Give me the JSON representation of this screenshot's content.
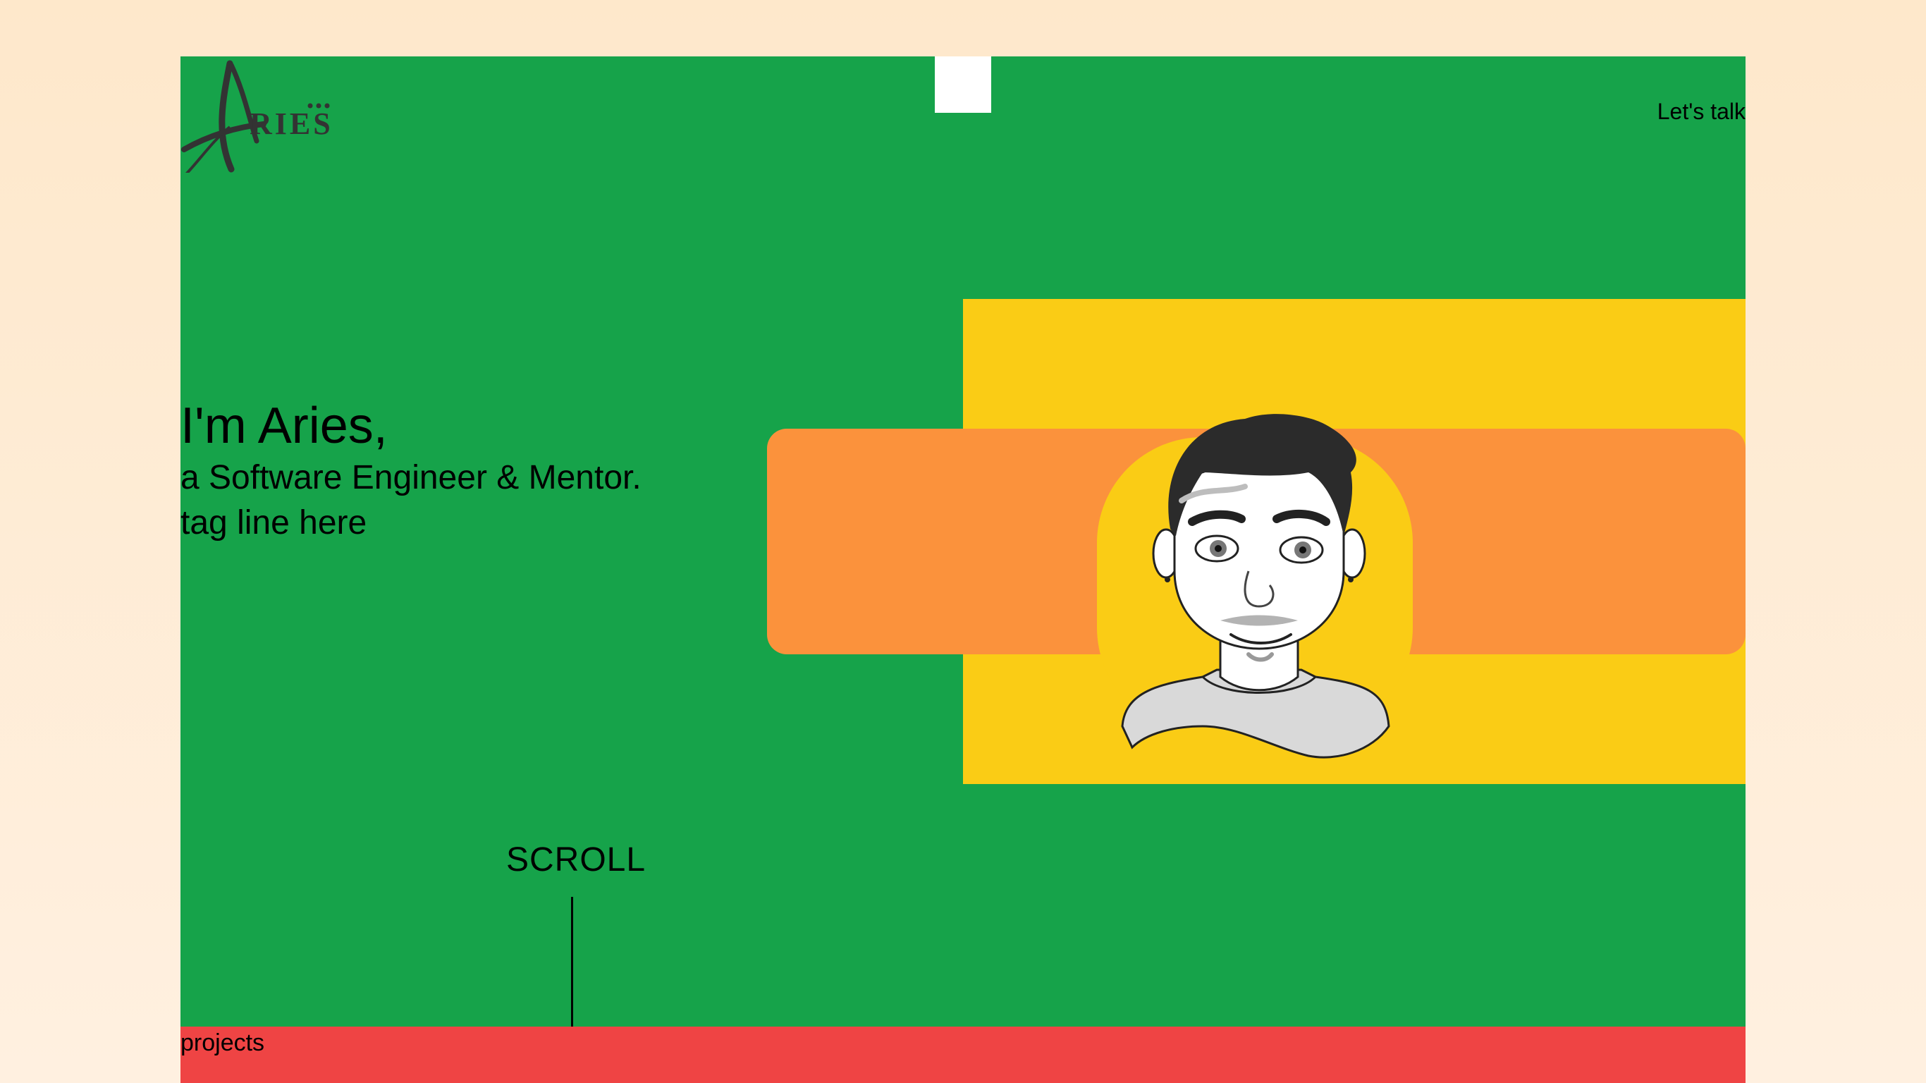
{
  "header": {
    "logo_text": "Aries",
    "cta_label": "Let's talk"
  },
  "hero": {
    "title": "I'm Aries,",
    "subtitle": "a Software Engineer & Mentor.",
    "tagline": "tag line here"
  },
  "scroll": {
    "label": "SCROLL"
  },
  "sections": {
    "projects_label": "projects"
  },
  "icons": {
    "logo": "aries-signature-logo",
    "portrait": "avatar-portrait-illustration"
  },
  "colors": {
    "page_bg": "#fee8cb",
    "frame_bg": "#16a34a",
    "panel_yellow": "#facc15",
    "band_orange": "#fb923c",
    "bar_red": "#ef4444"
  }
}
